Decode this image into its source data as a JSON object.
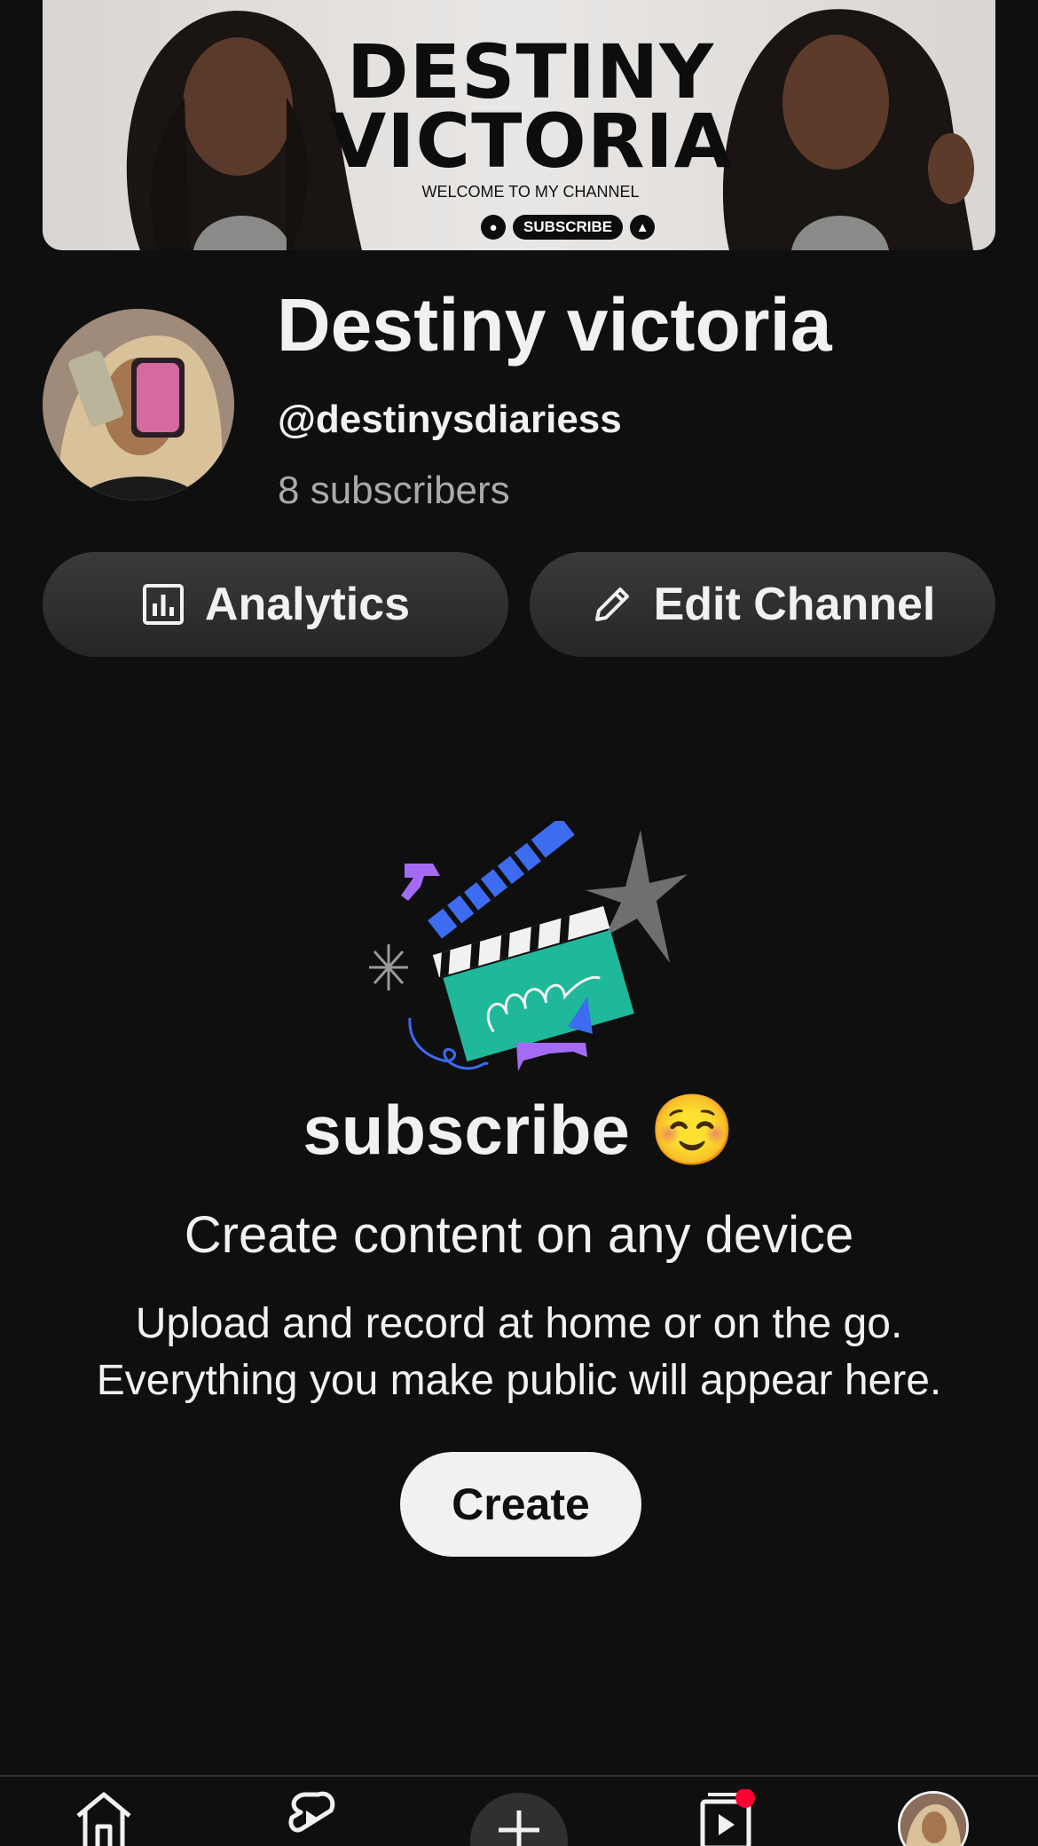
{
  "banner": {
    "title_line1": "DESTINY",
    "title_line2": "VICTORIA",
    "subtitle": "WELCOME TO MY CHANNEL",
    "subscribe_label": "SUBSCRIBE"
  },
  "channel": {
    "name": "Destiny victoria",
    "handle": "@destinysdiariess",
    "subscribers": "8 subscribers"
  },
  "actions": {
    "analytics_label": "Analytics",
    "edit_label": "Edit Channel"
  },
  "empty_state": {
    "title": "subscribe ☺️",
    "heading": "Create content on any device",
    "body_line1": "Upload and record at home or on the go.",
    "body_line2": "Everything you make public will appear here.",
    "create_label": "Create"
  },
  "bottom_nav": {
    "items": [
      "home-icon",
      "shorts-icon",
      "create-plus-icon",
      "subscriptions-icon",
      "profile-avatar"
    ],
    "notification_color": "#ff0033"
  },
  "colors": {
    "background": "#0f0f0f",
    "text": "#f1f1f1",
    "muted": "#aaaaaa",
    "pill": "#303030"
  }
}
